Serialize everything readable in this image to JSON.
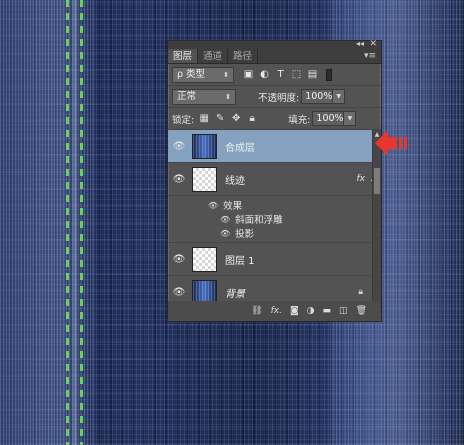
{
  "tabs": [
    {
      "label": "图层",
      "active": true
    },
    {
      "label": "通道",
      "active": false
    },
    {
      "label": "路径",
      "active": false
    }
  ],
  "filter": {
    "kind_label": "ρ 类型"
  },
  "blend": {
    "mode": "正常",
    "opacity_label": "不透明度:",
    "opacity_value": "100%"
  },
  "lock_row": {
    "lock_label": "锁定:",
    "fill_label": "填充:",
    "fill_value": "100%"
  },
  "layers": [
    {
      "name": "合成层",
      "thumb": "denim",
      "selected": true
    },
    {
      "name": "线迹",
      "thumb": "checker",
      "fx": "fx"
    },
    {
      "name": "图层 1",
      "thumb": "checker"
    },
    {
      "name": "背景",
      "thumb": "denim",
      "locked": true
    }
  ],
  "effects": {
    "title": "效果",
    "items": [
      "斜面和浮雕",
      "投影"
    ]
  },
  "bottom_icons": [
    "link-icon",
    "fx-icon",
    "mask-icon",
    "adjustment-icon",
    "folder-icon",
    "new-layer-icon",
    "trash-icon"
  ],
  "colors": {
    "selected_layer": "#84a1bf",
    "arrow": "#e8362e",
    "stitch": "#6cd05a"
  }
}
